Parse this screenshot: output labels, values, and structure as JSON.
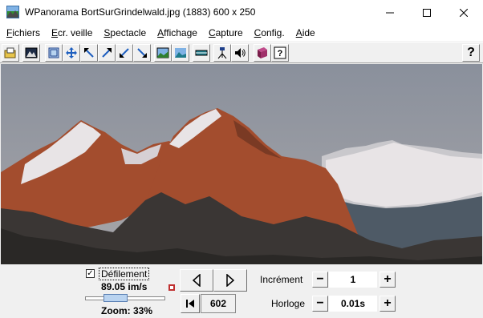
{
  "window": {
    "title": "WPanorama  BortSurGrindelwald.jpg  (1883) 600 x 250",
    "minimize_icon": "minimize-icon",
    "maximize_icon": "maximize-icon",
    "close_icon": "close-icon"
  },
  "menu": [
    {
      "key": "F",
      "rest": "ichiers"
    },
    {
      "key": "E",
      "rest": "cr. veille"
    },
    {
      "key": "S",
      "rest": "pectacle"
    },
    {
      "key": "A",
      "rest": "ffichage"
    },
    {
      "key": "C",
      "rest": "apture"
    },
    {
      "key": "C",
      "rest": "onfig."
    },
    {
      "key": "A",
      "rest": "ide"
    }
  ],
  "toolbar": {
    "icons": [
      "open-file-icon",
      "picture-icon",
      "fit-window-icon",
      "move-icon",
      "arrow-left-top-icon",
      "arrow-right-top-icon",
      "arrow-left-bottom-icon",
      "arrow-right-bottom-icon",
      "stretch-image-icon",
      "landscape-icon",
      "horizon-bar-icon",
      "tripod-icon",
      "sound-icon",
      "book-icon",
      "help-page-icon"
    ],
    "help_label": "?"
  },
  "controls": {
    "scroll_label": "Défilement",
    "scroll_checked": "✓",
    "speed": "89.05 im/s",
    "zoom": "Zoom: 33%",
    "zoom_fraction": 0.33,
    "frame": "602",
    "increment_label": "Incrément",
    "increment_value": "1",
    "clock_label": "Horloge",
    "clock_value": "0.01s",
    "minus": "−",
    "plus": "+"
  },
  "colors": {
    "sky_top": "#8a909c",
    "sky_bottom": "#a7a6a9",
    "rock_lit": "#a34d2e",
    "rock_shadow": "#3a3634",
    "snow": "#e8e4e6"
  }
}
